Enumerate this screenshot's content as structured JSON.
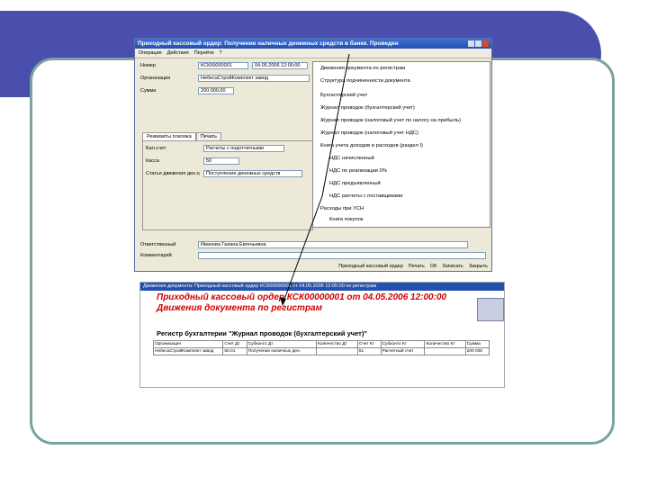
{
  "window": {
    "title": "Приходный кассовый ордер: Получение наличных денежных средств в банке. Проведен",
    "menu": [
      "Операция",
      "Действия",
      "Перейти",
      "?"
    ],
    "fields": {
      "number_label": "Номер",
      "number_value": "КСК00000001",
      "date_value": "04.05.2006 12:00:00",
      "org_label": "Организация",
      "org_value": "НебесаСтройКомплект завод",
      "sum_label": "Сумма",
      "sum_value": "200 000,00",
      "tab_details": "Реквизиты платежа",
      "tab_print": "Печать",
      "account_label": "Бал.счет",
      "account_value": "Расчеты с подотчетными",
      "cash_label": "Касса",
      "cash_value": "50",
      "purpose_label": "Статья движения ден.средств",
      "purpose_value": "Поступление денежных средств",
      "responsible_label": "Ответственный",
      "responsible_value": "Иванова Галина Евгеньевна",
      "comment_label": "Комментарий"
    },
    "bottom": [
      "Приходный кассовый ордер",
      "Печать",
      "ОК",
      "Записать",
      "Закрыть"
    ]
  },
  "dropdown_menu": {
    "items": [
      "Движения документа по регистрам",
      "Структура подчиненности документа",
      "Бухгалтерский учет",
      "Журнал проводок (бухгалтерский учет)",
      "Журнал проводок (налоговый учет по налогу на прибыль)",
      "Журнал проводок (налоговый учет НДС)",
      "Книга учета доходов и расходов (раздел I)",
      "НДС начисленный",
      "НДС по реализации 0%",
      "НДС предъявленный",
      "НДС расчеты с поставщиками",
      "Расходы при УСН",
      "Книга покупок"
    ]
  },
  "report": {
    "titlebar": "Движения документа: Приходный кассовый ордер КСК00000001 от 04.05.2006 12:00:00 по регистрам",
    "heading1": "Приходный кассовый ордер КСК00000001 от 04.05.2006 12:00:00",
    "heading2": "Движения документа по регистрам",
    "register": "Регистр бухгалтерии \"Журнал проводок (бухгалтерский учет)\"",
    "columns": [
      "Организация",
      "Счет Дт",
      "Субконто Дт",
      "Количество Дт",
      "Счет Кт",
      "Субконто Кт",
      "Количество Кт",
      "Сумма"
    ],
    "rows": [
      [
        "НебесаСтройКомплект завод",
        "50.01",
        "Получение наличных ден.",
        "",
        "51",
        "Расчетный счет",
        "",
        "200 000"
      ]
    ]
  }
}
